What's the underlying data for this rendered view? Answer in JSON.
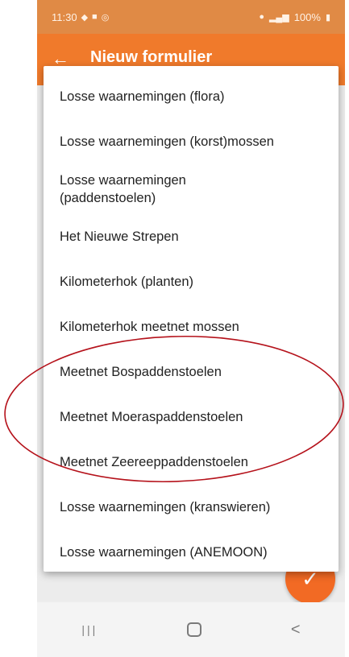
{
  "statusbar": {
    "time": "11:30",
    "battery": "100%"
  },
  "appbar": {
    "back_icon": "←",
    "title": "Nieuw formulier"
  },
  "menu": {
    "items": [
      {
        "label": "Losse waarnemingen (flora)"
      },
      {
        "label": "Losse waarnemingen (korst)mossen"
      },
      {
        "label": "Losse waarnemingen (paddenstoelen)"
      },
      {
        "label": "Het Nieuwe Strepen"
      },
      {
        "label": "Kilometerhok (planten)"
      },
      {
        "label": "Kilometerhok meetnet mossen"
      },
      {
        "label": "Meetnet Bospaddenstoelen"
      },
      {
        "label": "Meetnet Moeraspaddenstoelen"
      },
      {
        "label": "Meetnet Zeereeppaddenstoelen"
      },
      {
        "label": "Losse waarnemingen (kranswieren)"
      },
      {
        "label": "Losse waarnemingen (ANEMOON)"
      }
    ]
  },
  "fab": {
    "icon": "✓"
  },
  "navbar": {
    "recents_icon": "|||",
    "back_icon": "<"
  },
  "colors": {
    "appbar": "#f07a2b",
    "statusbar": "#e08a45",
    "fab": "#f26a24",
    "annotation": "#b5121b"
  }
}
